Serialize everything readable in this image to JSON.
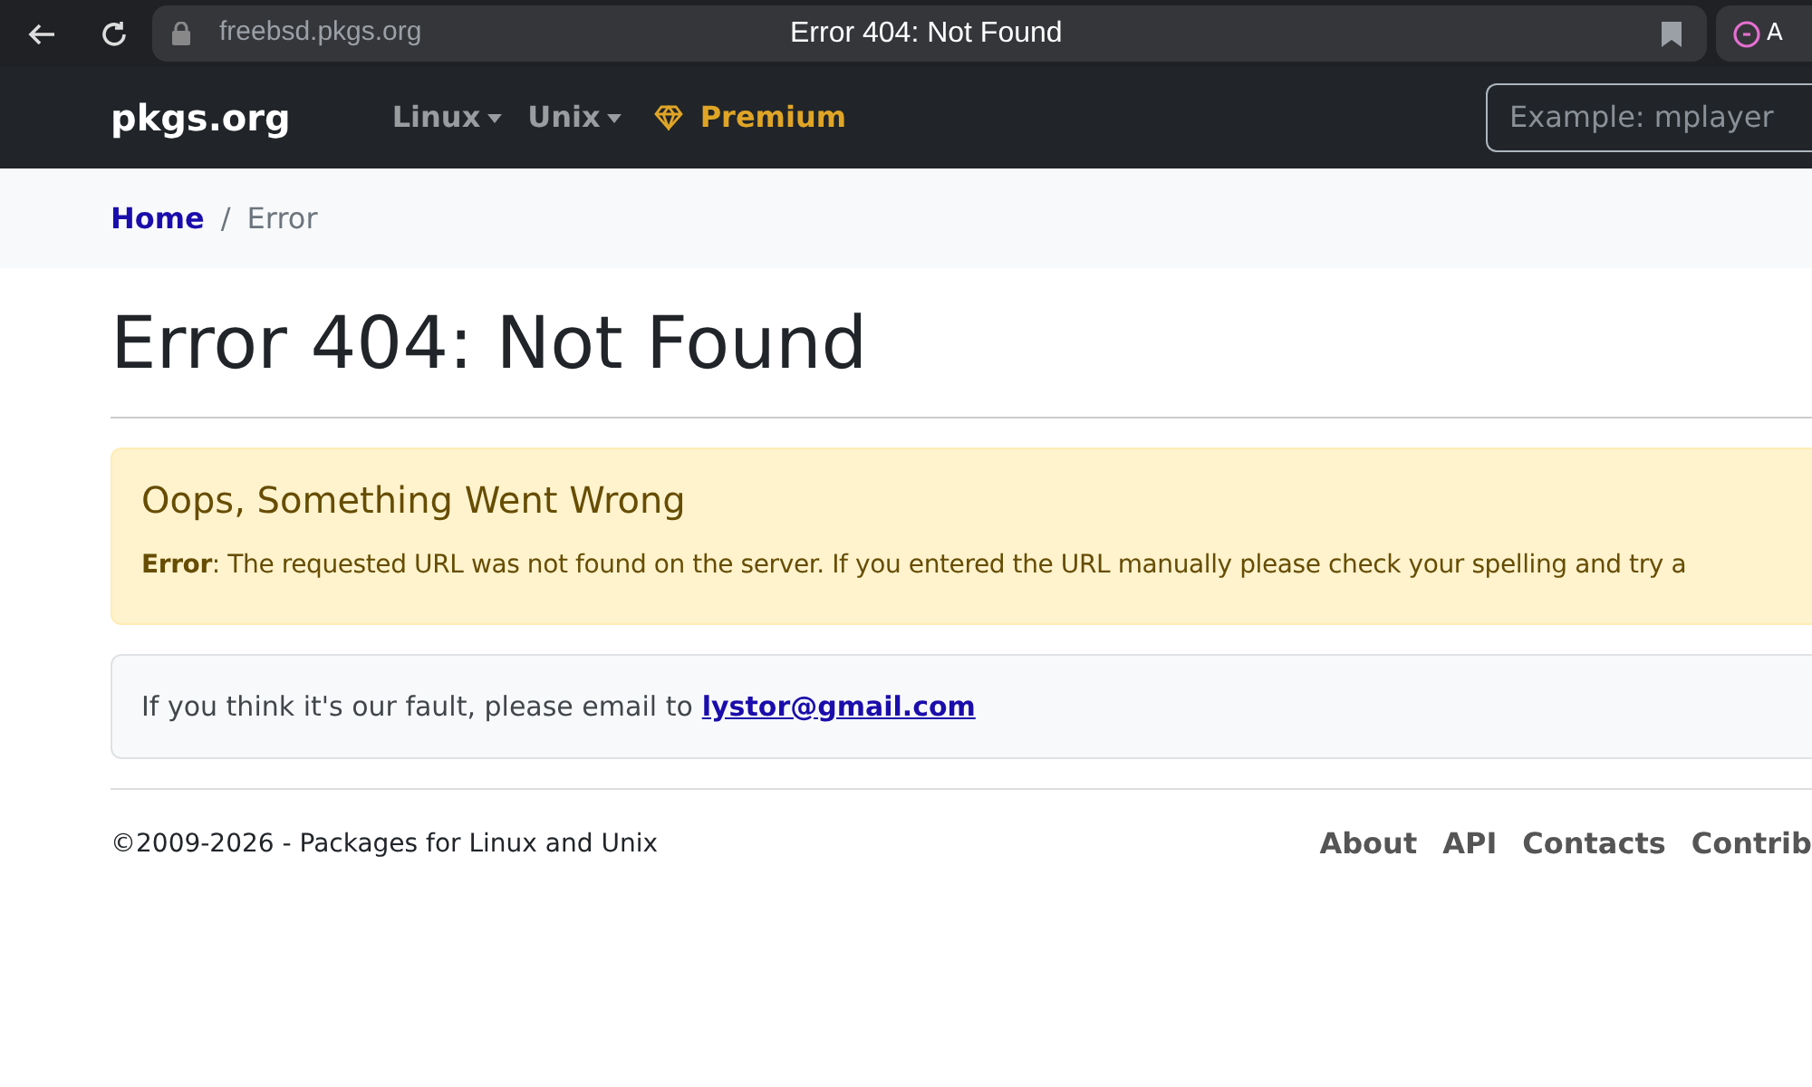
{
  "browser": {
    "url": "freebsd.pkgs.org",
    "tab_title": "Error 404: Not Found",
    "extension_label": "A"
  },
  "navbar": {
    "brand": "pkgs.org",
    "menus": [
      {
        "label": "Linux",
        "kind": "dropdown"
      },
      {
        "label": "Unix",
        "kind": "dropdown"
      },
      {
        "label": "Premium",
        "kind": "premium"
      }
    ],
    "search": {
      "placeholder": "Example: mplayer"
    }
  },
  "breadcrumb": {
    "separator": "/",
    "items": [
      {
        "label": "Home",
        "kind": "link"
      },
      {
        "label": "Error",
        "kind": "current"
      }
    ]
  },
  "heading": "Error 404: Not Found",
  "alert": {
    "title": "Oops, Something Went Wrong",
    "message": "**Error**: The requested URL was not found on the server. If you entered the URL manually please check your spelling and try a"
  },
  "notice": {
    "text": "If you think it's our fault, please email to",
    "email": "lystor@gmail.com"
  },
  "footer": {
    "copyright": "©2009-2026 - Packages for Linux and Unix",
    "links": [
      "About",
      "API",
      "Contacts",
      "Contrib"
    ]
  }
}
